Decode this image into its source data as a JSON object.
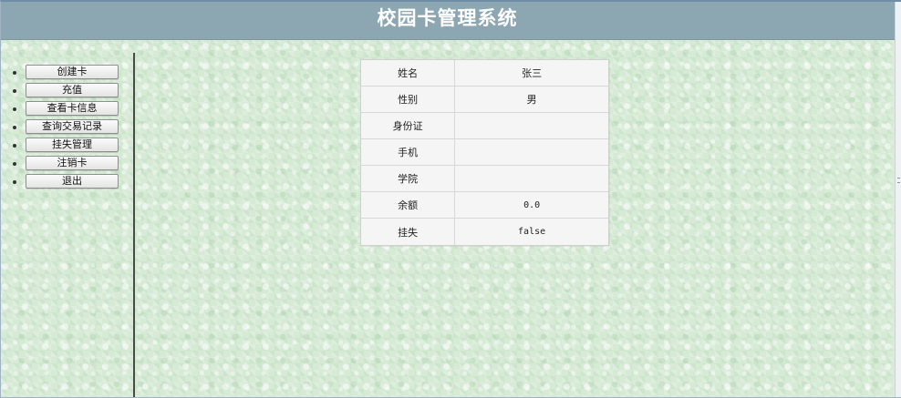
{
  "header": {
    "title": "校园卡管理系统"
  },
  "sidebar": {
    "items": [
      {
        "label": "创建卡"
      },
      {
        "label": "充值"
      },
      {
        "label": "查看卡信息"
      },
      {
        "label": "查询交易记录"
      },
      {
        "label": "挂失管理"
      },
      {
        "label": "注销卡"
      },
      {
        "label": "退出"
      }
    ]
  },
  "card_info": {
    "rows": [
      {
        "label": "姓名",
        "value": "张三"
      },
      {
        "label": "性别",
        "value": "男"
      },
      {
        "label": "身份证",
        "value": ""
      },
      {
        "label": "手机",
        "value": ""
      },
      {
        "label": "学院",
        "value": ""
      },
      {
        "label": "余额",
        "value": "0.0"
      },
      {
        "label": "挂失",
        "value": "false"
      }
    ]
  },
  "colors": {
    "header_bg": "#8ca7b2",
    "page_bg": "#d6ead6",
    "table_bg": "#f5f5f5"
  }
}
